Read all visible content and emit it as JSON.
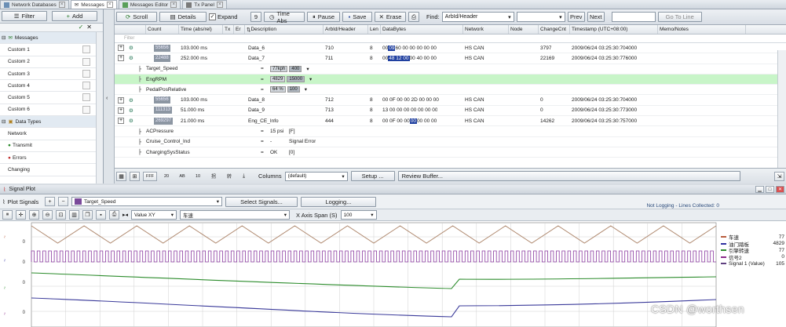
{
  "tabs": [
    {
      "label": "Network Databases",
      "icon": "database-icon"
    },
    {
      "label": "Messages",
      "icon": "messages-icon"
    },
    {
      "label": "Messages Editor",
      "icon": "editor-icon"
    },
    {
      "label": "Tx Panel",
      "icon": "tx-panel-icon"
    }
  ],
  "left": {
    "filter_label": "Filter",
    "add_label": "Add",
    "messages_group": "Messages",
    "customs": [
      "Custom 1",
      "Custom 2",
      "Custom 3",
      "Custom 4",
      "Custom 5",
      "Custom 6"
    ],
    "data_types_group": "Data Types",
    "data_types": [
      "Network",
      "Transmit",
      "Errors",
      "Changing"
    ]
  },
  "toolbar": {
    "scroll": "Scroll",
    "details": "Details",
    "expand": "Expand",
    "expand_checked": true,
    "nine": "9",
    "time_abs": "Time Abs",
    "pause": "Pause",
    "save": "Save",
    "erase": "Erase",
    "find_label": "Find:",
    "find_value": "ArbId/Header",
    "prev": "Prev",
    "next": "Next",
    "goto": "Go To Line"
  },
  "columns": [
    "Count",
    "Time (abs/rel)",
    "Tx",
    "Er",
    "Description",
    "ArbId/Header",
    "Len",
    "DataBytes",
    "Network",
    "Node",
    "ChangeCnt",
    "Timestamp (UTC+08:00)",
    "Memo/Notes"
  ],
  "filter_placeholder": "Filter",
  "rows": [
    {
      "type": "msg",
      "count": "55656",
      "time": "103.000 ms",
      "desc": "Data_6",
      "arbid": "710",
      "len": "8",
      "data_pre": "00 ",
      "data_sel": "09",
      "data_post": " 60 00 00 00 00 00",
      "network": "HS CAN",
      "changecnt": "3797",
      "ts": "2009/06/24 03:25:30:704000"
    },
    {
      "type": "msg",
      "count": "22488",
      "time": "252.000 ms",
      "desc": "Data_7",
      "arbid": "711",
      "len": "8",
      "data_pre": "00 ",
      "data_sel": "48 12 00",
      "data_post": " 00 40 00 00",
      "network": "HS CAN",
      "changecnt": "22169",
      "ts": "2009/06/24 03:25:30:776000"
    },
    {
      "type": "sig",
      "name": "Target_Speed",
      "val": "77kph",
      "box": "400",
      "unit": ""
    },
    {
      "type": "sig",
      "name": "EngRPM",
      "val": "4829",
      "box": "15000",
      "unit": "",
      "hl": true
    },
    {
      "type": "sig",
      "name": "PedalPosRelative",
      "val": "64 %",
      "box": "100",
      "unit": ""
    },
    {
      "type": "msg",
      "count": "55656",
      "time": "103.000 ms",
      "desc": "Data_8",
      "arbid": "712",
      "len": "8",
      "data_pre": "00 0F 00 00 2D 00 00 00",
      "data_sel": "",
      "data_post": "",
      "network": "HS CAN",
      "changecnt": "0",
      "ts": "2009/06/24 03:25:30:704000"
    },
    {
      "type": "msg",
      "count": "111313",
      "time": "51.000 ms",
      "desc": "Data_9",
      "arbid": "713",
      "len": "8",
      "data_pre": "13 00 00 00 00 00 00 00",
      "data_sel": "",
      "data_post": "",
      "network": "HS CAN",
      "changecnt": "0",
      "ts": "2009/06/24 03:25:30:773000"
    },
    {
      "type": "msg",
      "count": "269297",
      "time": "21.000 ms",
      "desc": "Eng_CE_Info",
      "arbid": "444",
      "len": "8",
      "data_pre": "00 0F 00 00 ",
      "data_sel": "00",
      "data_post": " 00 00 00",
      "network": "HS CAN",
      "changecnt": "14262",
      "ts": "2009/06/24 03:25:30:757000"
    },
    {
      "type": "sig2",
      "name": "ACPressure",
      "val": "15 psi",
      "extra": "[F]"
    },
    {
      "type": "sig2",
      "name": "Cruise_Control_Ind",
      "val": "-",
      "extra": "Signal Error"
    },
    {
      "type": "sig2",
      "name": "ChargingSysStatus",
      "val": "OK",
      "extra": "[0]"
    }
  ],
  "bottom": {
    "fmt_buttons": [
      "FFF",
      "20",
      "AB",
      "10",
      "拐",
      "转"
    ],
    "columns_label": "Columns",
    "columns_value": "(default)",
    "setup": "Setup ...",
    "review": "Review Buffer..."
  },
  "plot": {
    "title": "Signal Plot",
    "plot_signals": "Plot Signals",
    "signal_value": "Target_Speed",
    "select_signals": "Select Signals...",
    "logging": "Logging...",
    "status": "Not Logging - Lines Collected: 0",
    "mode_value": "Value XY",
    "y_signal": "车速",
    "x_span_label": "X Axis Span (S)",
    "x_span_value": "100",
    "y_ticks": [
      "0",
      "0",
      "0",
      "0"
    ],
    "legend": [
      {
        "name": "车速",
        "value": "77",
        "color": "#b85c3c"
      },
      {
        "name": "油门踏板",
        "value": "4829",
        "color": "#3030a0"
      },
      {
        "name": "引擎转速",
        "value": "77",
        "color": "#2c8c2c"
      },
      {
        "name": "信号2",
        "value": "0",
        "color": "#8a2a8a"
      },
      {
        "name": "Signal 1 (Value)",
        "value": "105",
        "color": "#604080"
      }
    ]
  },
  "watermark": "CSDN @worthsen"
}
